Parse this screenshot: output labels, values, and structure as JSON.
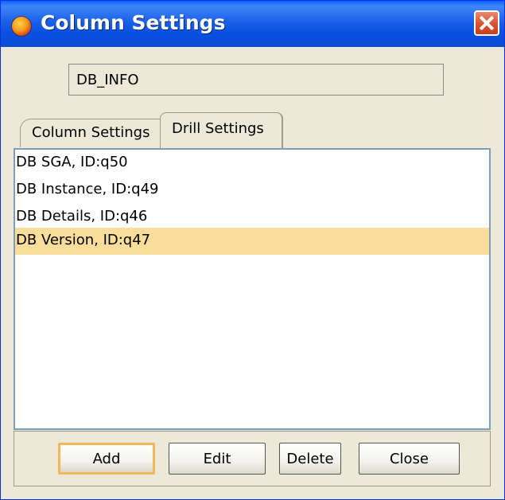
{
  "window": {
    "title": "Column Settings"
  },
  "name_field": {
    "value": "DB_INFO"
  },
  "tabs": [
    {
      "label": "Column Settings"
    },
    {
      "label": "Drill Settings"
    }
  ],
  "active_tab": "Drill Settings",
  "list": {
    "items": [
      {
        "label": "DB SGA, ID:q50"
      },
      {
        "label": "DB Instance, ID:q49"
      },
      {
        "label": "DB Details, ID:q46"
      },
      {
        "label": "DB Version, ID:q47"
      }
    ],
    "selected_index": 3
  },
  "buttons": {
    "add": "Add",
    "edit": "Edit",
    "delete": "Delete",
    "close": "Close"
  },
  "colors": {
    "titlebar": "#0A5FFF",
    "selection": "#F8DD9B",
    "dialog_bg": "#ECE9D8",
    "close_button": "#D8502F"
  },
  "icons": {
    "app": "app-icon",
    "close": "close-icon"
  }
}
